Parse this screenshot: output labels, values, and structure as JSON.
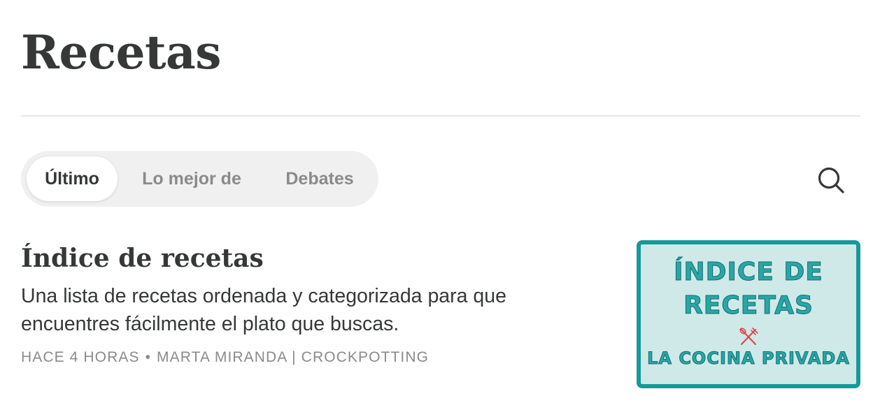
{
  "page": {
    "title": "Recetas"
  },
  "tabs": [
    {
      "label": "Último",
      "active": true
    },
    {
      "label": "Lo mejor de",
      "active": false
    },
    {
      "label": "Debates",
      "active": false
    }
  ],
  "search": {
    "icon": "search-icon"
  },
  "post": {
    "title": "Índice de recetas",
    "subtitle": "Una lista de recetas ordenada y categorizada para que encuentres fácilmente el plato que buscas.",
    "time": "HACE 4 HORAS",
    "separator": "•",
    "author": "MARTA MIRANDA | CROCKPOTTING",
    "thumbnail": {
      "line1": "ÍNDICE DE",
      "line2": "RECETAS",
      "line3": "LA COCINA PRIVADA",
      "icon": "utensils-icon",
      "colors": {
        "border": "#15999a",
        "background": "#cfe9e9",
        "text": "#2aa6a5",
        "icon": "#e0474c"
      }
    }
  }
}
